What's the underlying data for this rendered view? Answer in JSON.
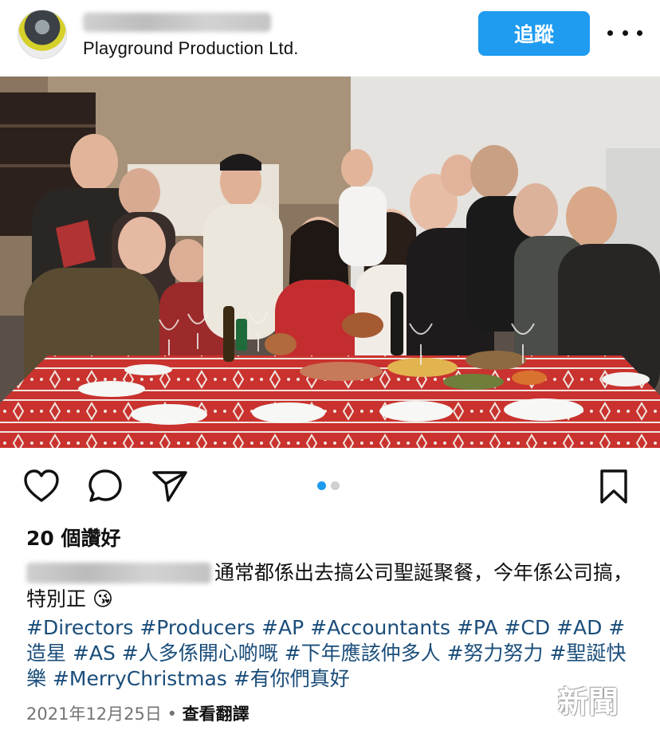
{
  "header": {
    "location": "Playground Production Ltd.",
    "follow_label": "追蹤",
    "more_icon": "more-horizontal-icon"
  },
  "actions": {
    "like_icon": "heart-icon",
    "comment_icon": "comment-icon",
    "share_icon": "send-icon",
    "save_icon": "bookmark-icon",
    "carousel_total": 2,
    "carousel_active": 1
  },
  "likes_text": "20 個讚好",
  "caption": {
    "text": "通常都係出去搞公司聖誕聚餐，今年係公司搞，特別正",
    "emoji": "😘"
  },
  "hashtags": "#Directors #Producers #AP #Accountants #PA #CD #AD #造星 #AS #人多係開心啲嘅 #下年應該仲多人 #努力努力 #聖誕快樂 #MerryChristmas #有你們真好",
  "date": "2021年12月25日",
  "separator": " • ",
  "translate_label": "查看翻譯",
  "watermark": "新聞",
  "colors": {
    "follow_button": "#1f9bf0",
    "hashtag": "#1a4d7a",
    "carousel_active": "#1f9bf0"
  }
}
